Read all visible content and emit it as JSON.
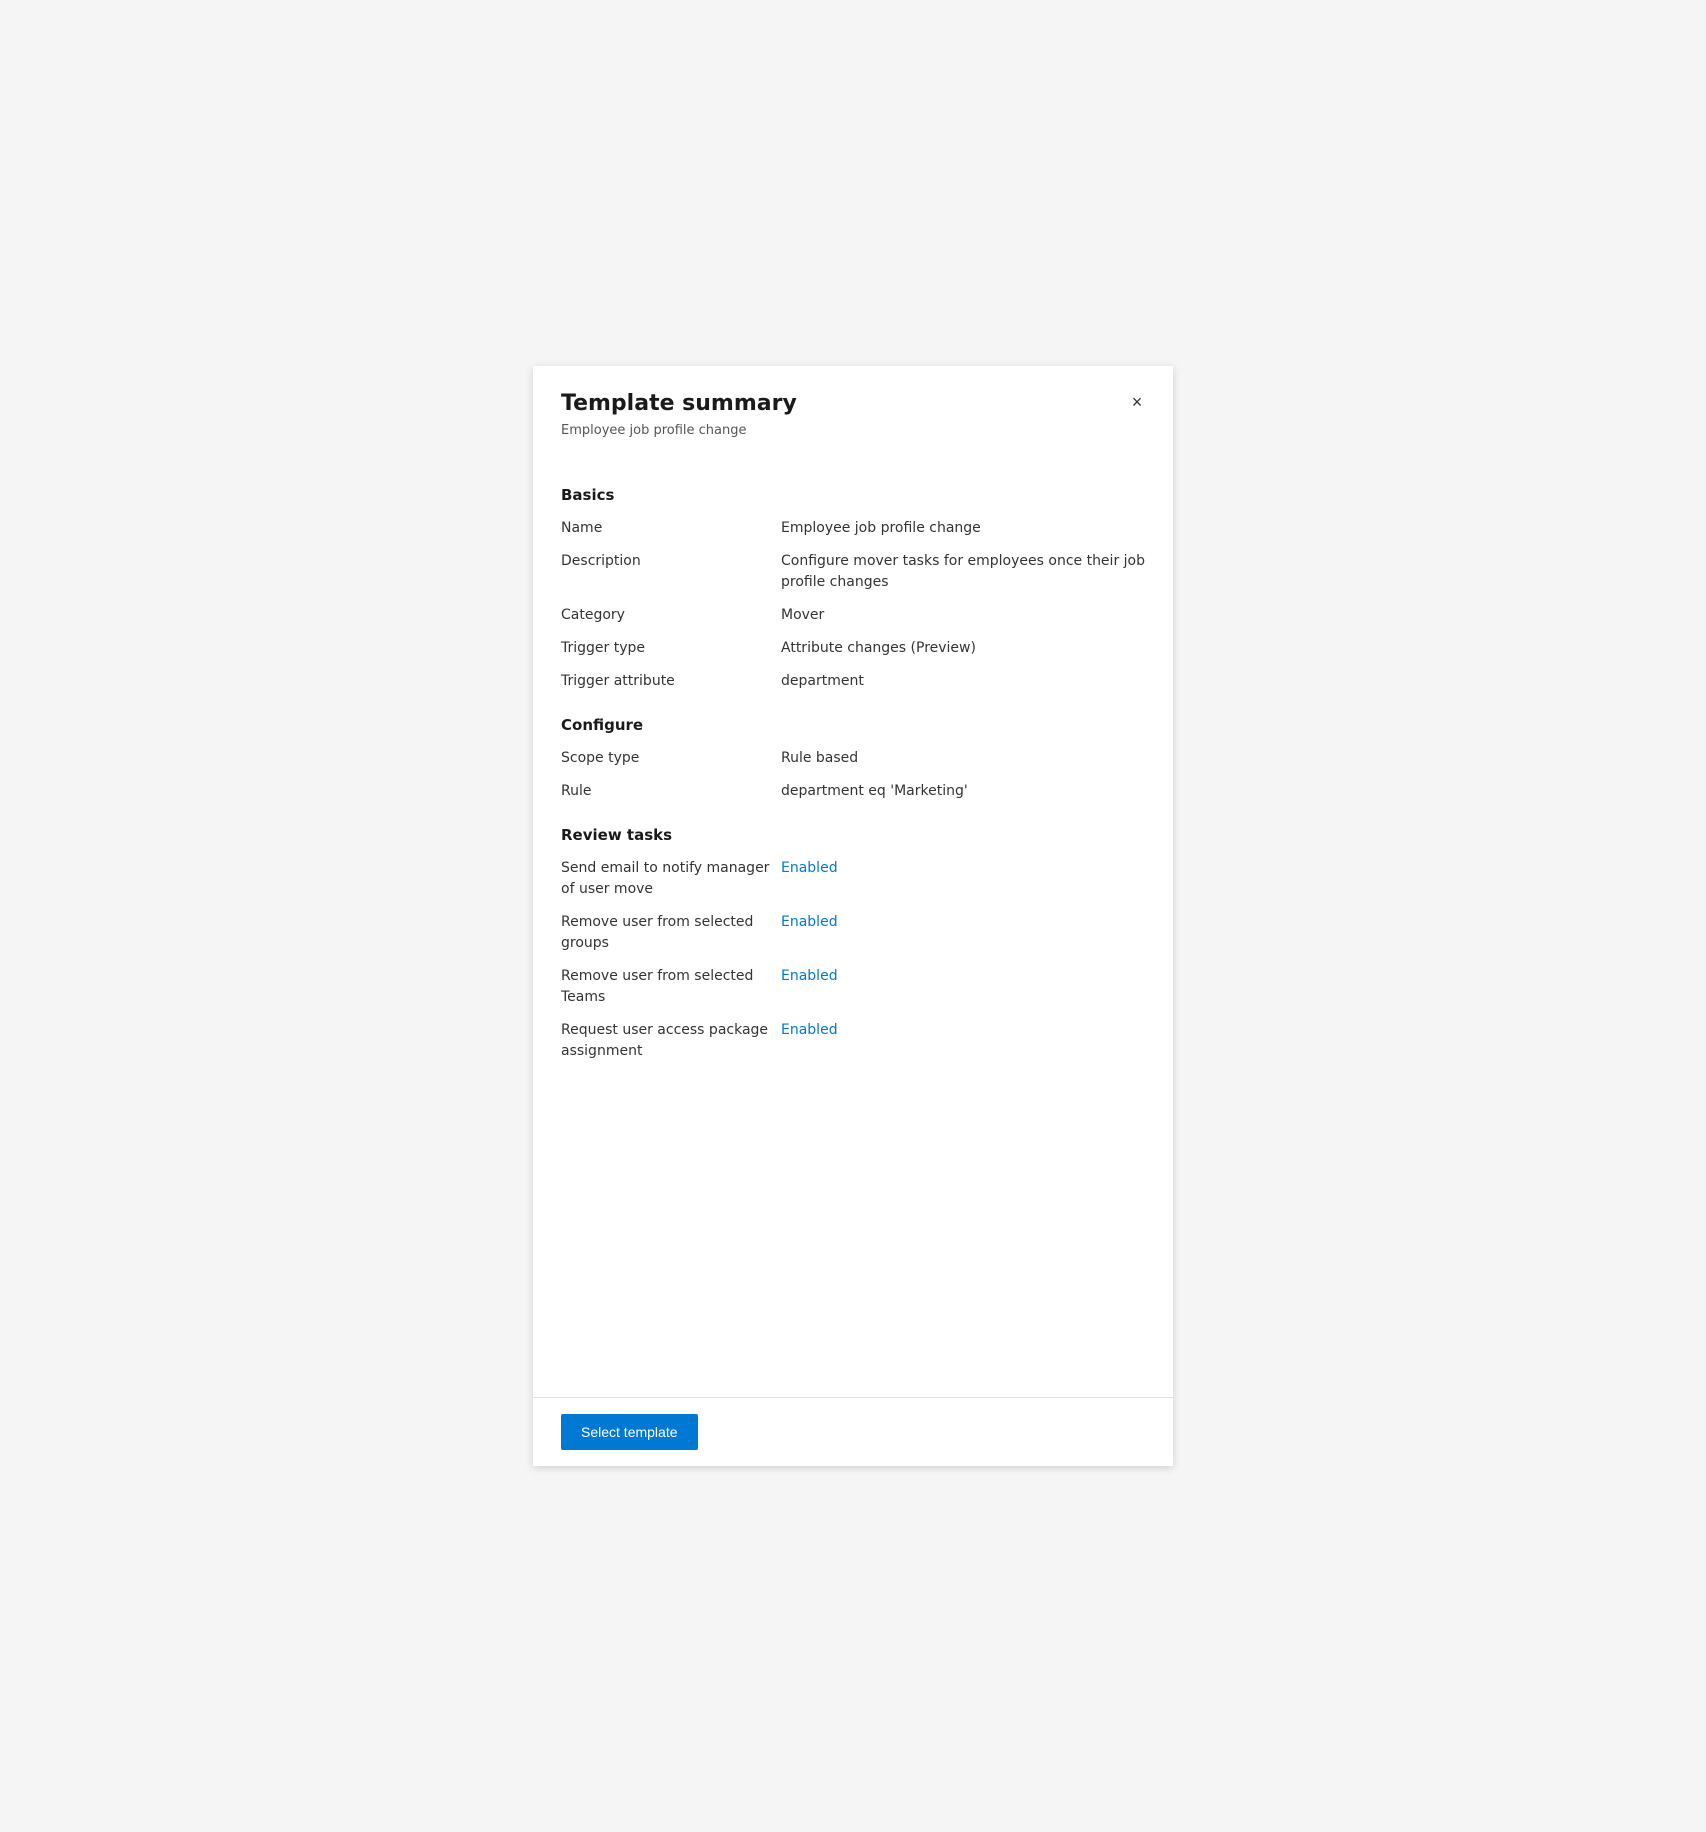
{
  "header": {
    "title": "Template summary",
    "subtitle": "Employee job profile change",
    "close_icon": "×"
  },
  "sections": {
    "basics": {
      "title": "Basics",
      "rows": [
        {
          "label": "Name",
          "value": "Employee job profile change",
          "enabled": false
        },
        {
          "label": "Description",
          "value": "Configure mover tasks for employees once their job profile changes",
          "enabled": false
        },
        {
          "label": "Category",
          "value": "Mover",
          "enabled": false
        },
        {
          "label": "Trigger type",
          "value": "Attribute changes (Preview)",
          "enabled": false
        },
        {
          "label": "Trigger attribute",
          "value": "department",
          "enabled": false
        }
      ]
    },
    "configure": {
      "title": "Configure",
      "rows": [
        {
          "label": "Scope type",
          "value": "Rule based",
          "enabled": false
        },
        {
          "label": "Rule",
          "value": "department eq 'Marketing'",
          "enabled": false
        }
      ]
    },
    "review_tasks": {
      "title": "Review tasks",
      "rows": [
        {
          "label": "Send email to notify manager of user move",
          "value": "Enabled",
          "enabled": true
        },
        {
          "label": "Remove user from selected groups",
          "value": "Enabled",
          "enabled": true
        },
        {
          "label": "Remove user from selected Teams",
          "value": "Enabled",
          "enabled": true
        },
        {
          "label": "Request user access package assignment",
          "value": "Enabled",
          "enabled": true
        }
      ]
    }
  },
  "footer": {
    "select_template_label": "Select template"
  }
}
